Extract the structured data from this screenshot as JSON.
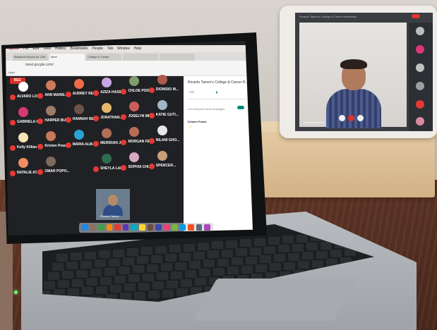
{
  "laptop": {
    "menubar": {
      "app": "Opera",
      "items": [
        "File",
        "Edit",
        "View",
        "History",
        "Bookmarks",
        "People",
        "Tab",
        "Window",
        "Help"
      ]
    },
    "tabs": [
      "Breakout Rooms for Grid",
      "Meet",
      "College & Career",
      "",
      ""
    ],
    "url": "meet.google.com/",
    "bookmarks": [
      "Apps",
      "",
      "",
      "",
      "",
      ""
    ],
    "rec_label": "REC",
    "participants": [
      {
        "name": "ALVARO LOP...",
        "color": "#ffffff"
      },
      {
        "name": "ANN MARIE...",
        "color": "#d07a5a"
      },
      {
        "name": "AUDREY REU...",
        "color": "#ef6c47"
      },
      {
        "name": "AZIZA HASS...",
        "color": "#c9a7e6"
      },
      {
        "name": "CHLOE PODE...",
        "color": "#7f9c6a"
      },
      {
        "name": "DIONISIO M...",
        "color": "#b05c4a"
      },
      {
        "name": "GABRIELA C...",
        "color": "#d63b6f"
      },
      {
        "name": "HARPER BUE...",
        "color": "#9c7b68"
      },
      {
        "name": "HANNAH NE...",
        "color": "#6d5248"
      },
      {
        "name": "JONATHAN...",
        "color": "#e6b86b"
      },
      {
        "name": "JOSELYN MI...",
        "color": "#cc5d5d"
      },
      {
        "name": "KATIE GUTI...",
        "color": "#a1b6c9"
      },
      {
        "name": "Kelly Killian",
        "color": "#f6e6b4"
      },
      {
        "name": "Kristen Power",
        "color": "#c57a5a"
      },
      {
        "name": "MARIA ALM...",
        "color": "#29a3d6"
      },
      {
        "name": "MERIDIAN J...",
        "color": "#b07058"
      },
      {
        "name": "MORGAN FE...",
        "color": "#b86b56"
      },
      {
        "name": "NILANI GHO...",
        "color": "#e6e6e6"
      },
      {
        "name": "NATALIE AT...",
        "color": "#ef8e62"
      },
      {
        "name": "OMAR POPO...",
        "color": "#7d6a5b"
      },
      {
        "name": "SHEYLA LAR...",
        "color": "#2f6b4f"
      },
      {
        "name": "SOPHIA CHI...",
        "color": "#d6a8c2"
      },
      {
        "name": "SPENCER...",
        "color": "#c9a07a"
      }
    ],
    "featured_name": "Ricardo Tamez",
    "side_panel": {
      "title": "Ricardo Tamez's College & Career R...",
      "tabs": [
        "275",
        "",
        ""
      ],
      "message_setting": "Let everyone send messages",
      "sender": "Kristen Power",
      "emoji": "☺"
    }
  },
  "ipad": {
    "title": "Ricardo Tamez's College & Career Readiness",
    "name": "Ricardo Tamez"
  },
  "colors": {
    "meet_bg": "#202124",
    "rec": "#d93025",
    "accent": "#00897b"
  },
  "icons": [
    "mic-off-icon",
    "record-icon",
    "end-call-icon",
    "camera-icon",
    "mic-icon"
  ]
}
